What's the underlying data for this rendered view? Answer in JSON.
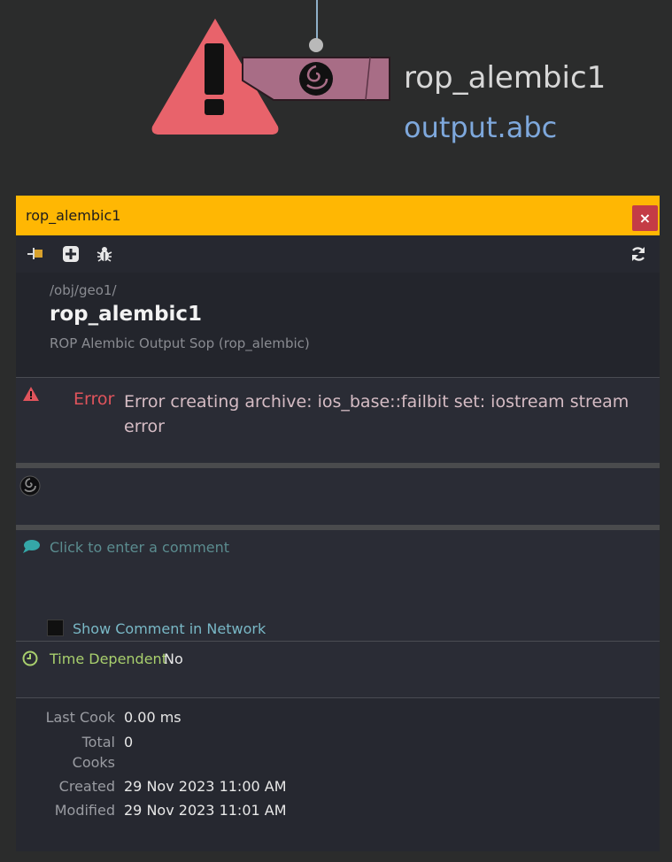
{
  "graph": {
    "node_name": "rop_alembic1",
    "output_file": "output.abc"
  },
  "panel": {
    "window_title": "rop_alembic1",
    "close_label": "×",
    "path": "/obj/geo1/",
    "node_title": "rop_alembic1",
    "node_type": "ROP Alembic Output Sop (rop_alembic)",
    "error_label": "Error",
    "error_message": "Error creating archive: ios_base::failbit set: iostream stream error",
    "comment_placeholder": "Click to enter a comment",
    "show_comment_label": "Show Comment in Network",
    "time_dependent_label": "Time Dependent",
    "time_dependent_value": "No",
    "stats": {
      "last_cook_label": "Last Cook",
      "last_cook_value": "0.00 ms",
      "total_cooks_label_1": "Total",
      "total_cooks_label_2": "Cooks",
      "total_cooks_value": "0",
      "created_label": "Created",
      "created_value": "29 Nov 2023 11:00 AM",
      "modified_label": "Modified",
      "modified_value": "29 Nov 2023 11:01 AM"
    }
  },
  "icons": {
    "toolbar": [
      "pin-icon",
      "add-icon",
      "debug-icon",
      "refresh-icon"
    ],
    "error": "warning-icon",
    "sop": "houdini-swirl-icon",
    "comment": "comment-icon",
    "time": "clock-icon"
  },
  "colors": {
    "titlebar": "#ffb703",
    "error": "#e0545c",
    "node_fill": "#a86d86",
    "output_link": "#7ea8dc",
    "time_dependent": "#a8cf6d"
  }
}
